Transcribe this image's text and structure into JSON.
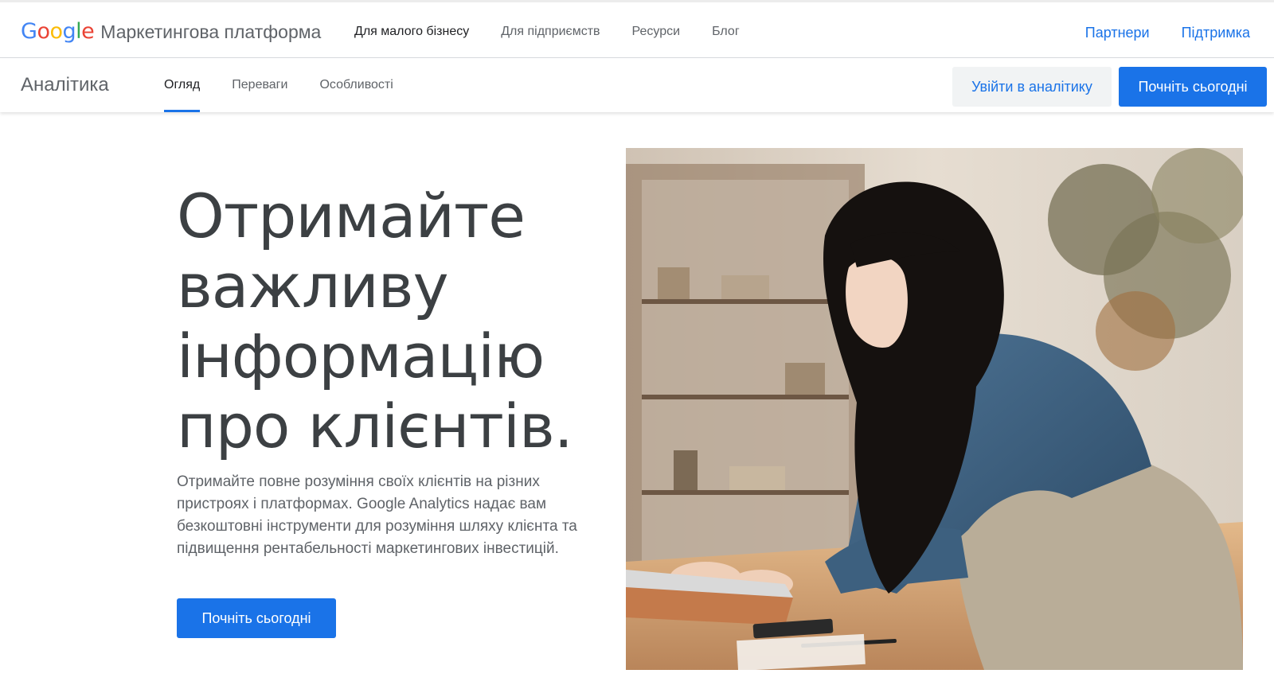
{
  "header": {
    "logo_letters": [
      "G",
      "o",
      "o",
      "g",
      "l",
      "e"
    ],
    "product": "Маркетингова платформа",
    "nav": [
      {
        "label": "Для малого бізнесу",
        "active": true
      },
      {
        "label": "Для підприємств"
      },
      {
        "label": "Ресурси"
      },
      {
        "label": "Блог"
      }
    ],
    "links": [
      "Партнери",
      "Підтримка"
    ]
  },
  "subheader": {
    "title": "Аналітика",
    "tabs": [
      "Огляд",
      "Переваги",
      "Особливості"
    ],
    "active_tab": "Огляд",
    "login_button": "Увійти в аналітику",
    "start_button": "Почніть сьогодні"
  },
  "hero": {
    "title_lines": [
      "Отримайте",
      "важливу",
      "інформацію",
      "про клієнтів."
    ],
    "description": "Отримайте повне розуміння своїх клієнтів на різних пристроях і платформах. Google Analytics надає вам безкоштовні інструменти для розуміння шляху клієнта та підвищення рентабельності маркетингових інвестицій.",
    "cta_button": "Почніть сьогодні",
    "image": "woman-using-laptop-in-shop-photo"
  },
  "colors": {
    "accent": "#1a73e8",
    "text_dark": "#3c4043",
    "text_muted": "#5f6368",
    "button_secondary_bg": "#f1f3f4"
  }
}
